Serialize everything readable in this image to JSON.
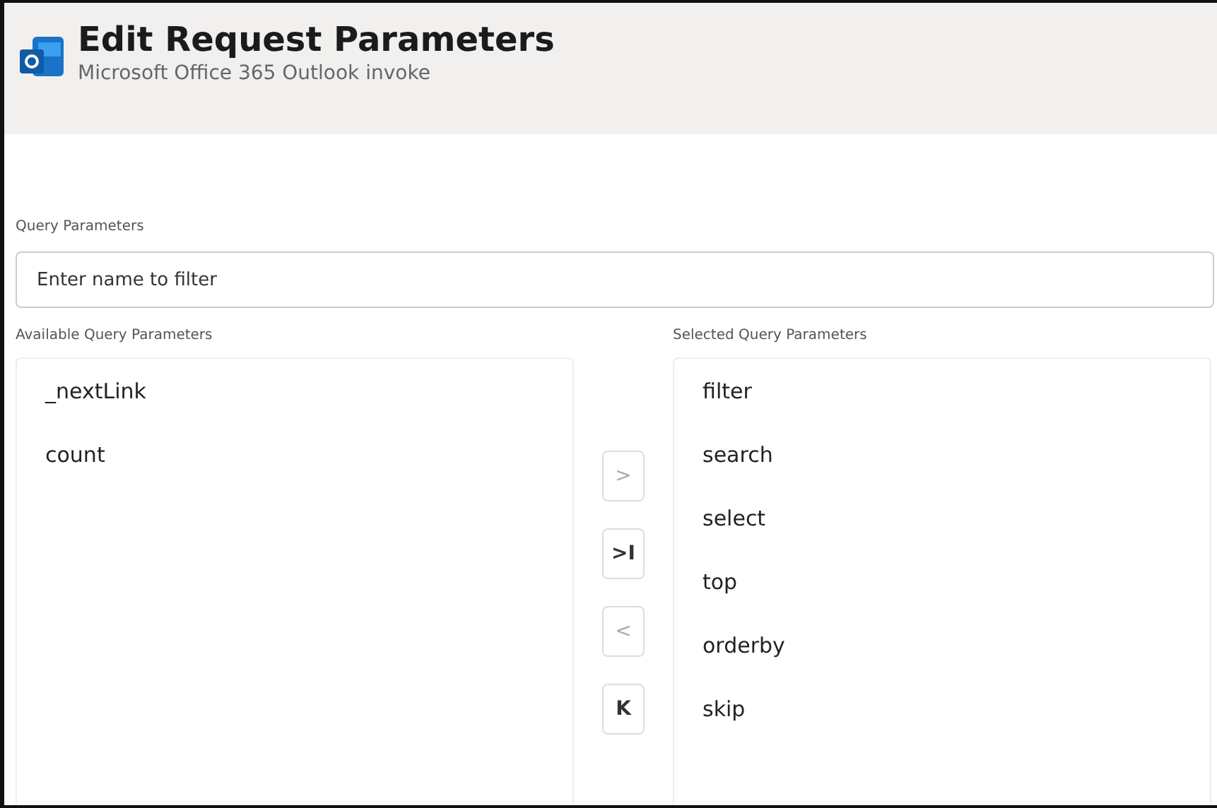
{
  "header": {
    "title": "Edit Request Parameters",
    "subtitle": "Microsoft Office 365 Outlook invoke"
  },
  "filter": {
    "label": "Query Parameters",
    "placeholder": "Enter name to filter"
  },
  "available": {
    "label": "Available Query Parameters",
    "items": [
      "_nextLink",
      "count"
    ]
  },
  "selected": {
    "label": "Selected Query Parameters",
    "items": [
      "filter",
      "search",
      "select",
      "top",
      "orderby",
      "skip"
    ]
  },
  "move_buttons": [
    {
      "glyph": ">",
      "disabled": true
    },
    {
      "glyph": ">I",
      "disabled": false
    },
    {
      "glyph": "<",
      "disabled": true
    },
    {
      "glyph": "K",
      "disabled": false
    }
  ]
}
